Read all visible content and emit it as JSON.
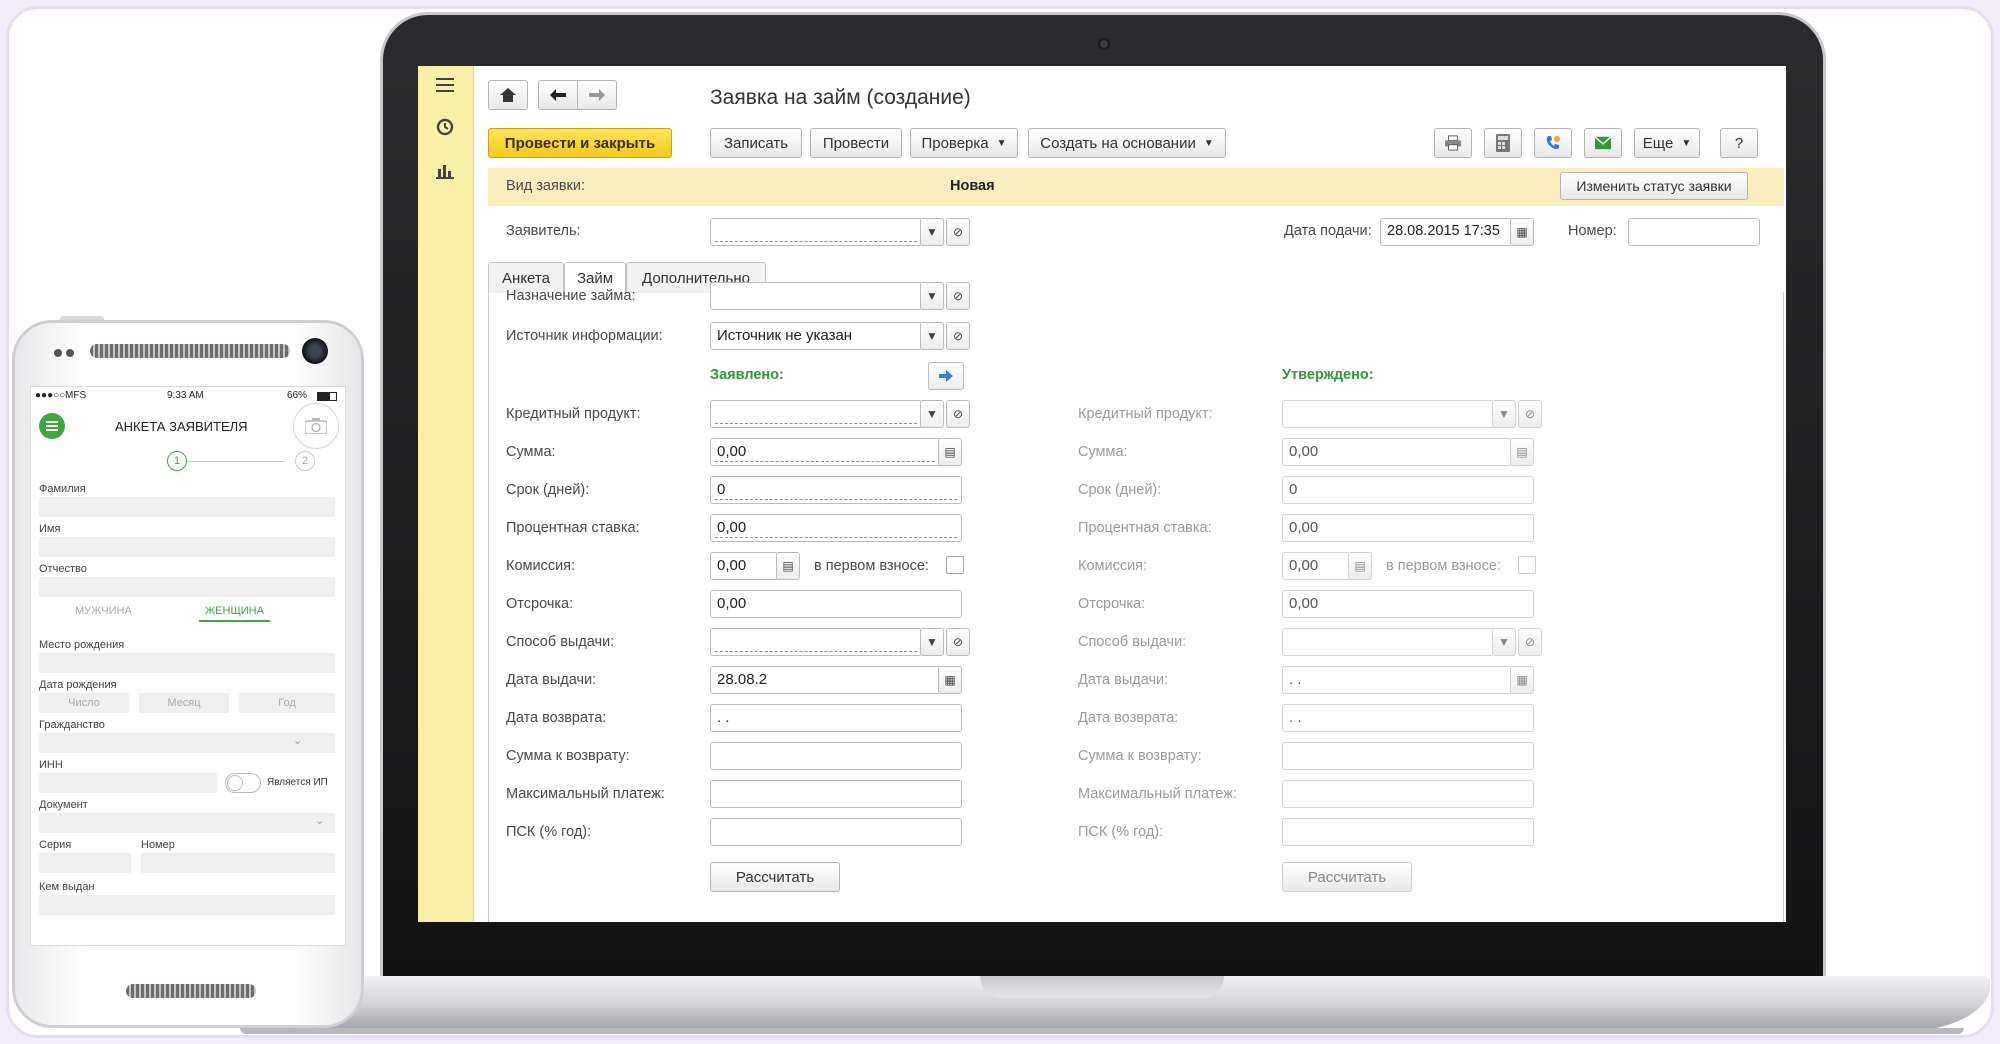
{
  "colors": {
    "accent_yellow": "#f4c81c",
    "sidebar_yellow": "#f8f0a6",
    "status_band": "#fbeebe",
    "green": "#2e9a39"
  },
  "laptop": {
    "sidebar": {
      "icons": [
        "menu-icon",
        "history-icon",
        "chart-icon"
      ]
    },
    "window_title": "Заявка на займ (создание)",
    "toolbar": {
      "home_icon": "home-icon",
      "back_icon": "arrow-left-icon",
      "forward_icon": "arrow-right-icon",
      "post_close": "Провести и закрыть",
      "save": "Записать",
      "post": "Провести",
      "check": "Проверка",
      "create_based": "Создать на основании",
      "print_icon": "print-icon",
      "calc_icon": "calculator-icon",
      "phone_icon": "phone-icon",
      "mail_icon": "mail-icon",
      "more": "Еще",
      "help": "?"
    },
    "header": {
      "kind_label": "Вид заявки:",
      "kind_value": "Новая",
      "change_status": "Изменить статус заявки",
      "applicant_label": "Заявитель:",
      "applicant_value": "",
      "date_label": "Дата подачи:",
      "date_value": "28.08.2015 17:35",
      "number_label": "Номер:",
      "number_value": ""
    },
    "tabs": [
      "Анкета",
      "Займ",
      "Дополнительно"
    ],
    "active_tab": "Займ",
    "form": {
      "purpose_label": "Назначение займа:",
      "purpose_value": "",
      "source_label": "Источник информации:",
      "source_value": "Источник не указан",
      "declared_header": "Заявлено:",
      "approved_header": "Утверждено:",
      "copy_icon": "arrow-right-icon",
      "calc_button": "Рассчитать",
      "declared": {
        "product_label": "Кредитный продукт:",
        "product": "",
        "sum_label": "Сумма:",
        "sum": "0,00",
        "term_label": "Срок (дней):",
        "term": "0",
        "rate_label": "Процентная ставка:",
        "rate": "0,00",
        "fee_label": "Комиссия:",
        "fee": "0,00",
        "fee_first_label": "в первом взносе:",
        "delay_label": "Отсрочка:",
        "delay": "0,00",
        "method_label": "Способ выдачи:",
        "method": "",
        "issue_date_label": "Дата выдачи:",
        "issue_date": "28.08.2",
        "return_date_label": "Дата возврата:",
        "return_date": ". .",
        "return_sum_label": "Сумма к возврату:",
        "return_sum": "",
        "max_payment_label": "Максимальный платеж:",
        "max_payment": "",
        "psk_label": "ПСК (% год):",
        "psk": ""
      },
      "approved": {
        "product_label": "Кредитный продукт:",
        "product": "",
        "sum_label": "Сумма:",
        "sum": "0,00",
        "term_label": "Срок (дней):",
        "term": "0",
        "rate_label": "Процентная ставка:",
        "rate": "0,00",
        "fee_label": "Комиссия:",
        "fee": "0,00",
        "fee_first_label": "в первом взносе:",
        "delay_label": "Отсрочка:",
        "delay": "0,00",
        "method_label": "Способ выдачи:",
        "method": "",
        "issue_date_label": "Дата выдачи:",
        "issue_date": ". .",
        "return_date_label": "Дата возврата:",
        "return_date": ". .",
        "return_sum_label": "Сумма к возврату:",
        "return_sum": "",
        "max_payment_label": "Максимальный платеж:",
        "max_payment": "",
        "psk_label": "ПСК (% год):",
        "psk": ""
      }
    }
  },
  "phone": {
    "status": {
      "carrier": "MFS",
      "time": "9:33 AM",
      "battery": "66%"
    },
    "title": "АНКЕТА ЗАЯВИТЕЛЯ",
    "steps": [
      "1",
      "2"
    ],
    "surname_label": "Фамилия",
    "name_label": "Имя",
    "patronymic_label": "Отчество",
    "gender_male": "МУЖЧИНА",
    "gender_female": "ЖЕНЩИНА",
    "birthplace_label": "Место рождения",
    "birthdate_label": "Дата рождения",
    "birth_day": "Число",
    "birth_month": "Месяц",
    "birth_year": "Год",
    "citizenship_label": "Гражданство",
    "inn_label": "ИНН",
    "ip_label": "Является ИП",
    "document_label": "Документ",
    "series_label": "Серия",
    "number_label": "Номер",
    "issued_by_label": "Кем выдан"
  }
}
